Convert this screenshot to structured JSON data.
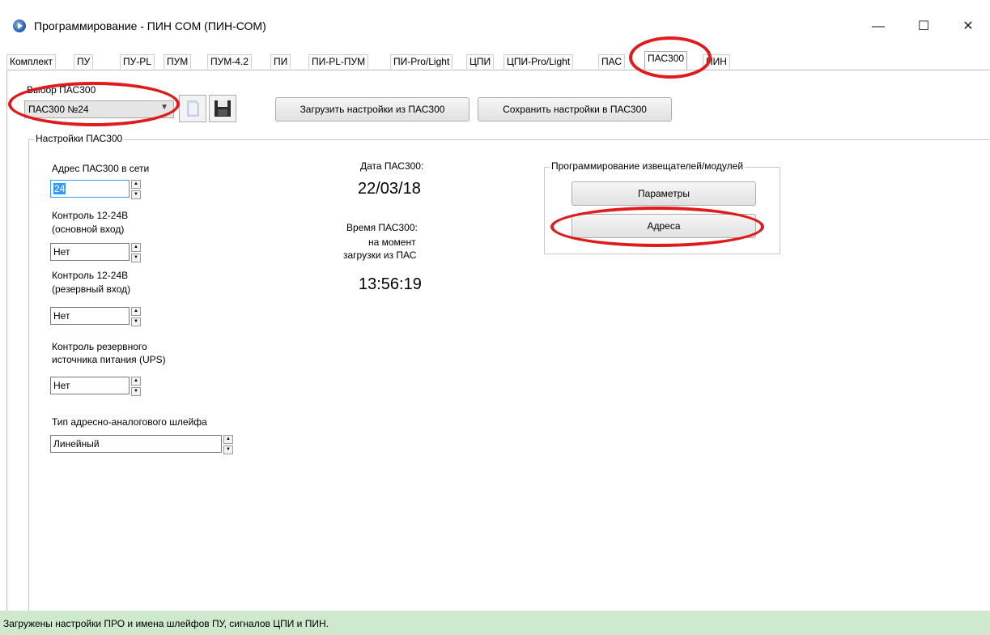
{
  "window": {
    "title": "Программирование - ПИН СОМ (ПИН-СОМ)",
    "minimize_glyph": "—",
    "maximize_glyph": "☐",
    "close_glyph": "✕"
  },
  "tabs": [
    "Комплект",
    "ПУ",
    "ПУ-PL",
    "ПУМ",
    "ПУМ-4.2",
    "ПИ",
    "ПИ-PL-ПУМ",
    "ПИ-Pro/Light",
    "ЦПИ",
    "ЦПИ-Pro/Light",
    "ПАС",
    "ПАС300",
    "ПИН"
  ],
  "active_tab": "ПАС300",
  "selector": {
    "label": "Выбор ПАС300",
    "value": "ПАС300 №24",
    "load_button": "Загрузить  настройки из ПАС300",
    "save_button": "Сохранить настройки в ПАС300",
    "open_icon": "folder-icon",
    "save_icon": "floppy-disk-icon"
  },
  "settings": {
    "group_title": "Настройки ПАС300",
    "address_label": "Адрес ПАС300 в сети",
    "address_value": "24",
    "control_main_label_1": "Контроль 12-24В",
    "control_main_label_2": "(основной вход)",
    "control_main_value": "Нет",
    "control_reserve_label_1": "Контроль 12-24В",
    "control_reserve_label_2": "(резервный вход)",
    "control_reserve_value": "Нет",
    "ups_label_1": "Контроль резервного",
    "ups_label_2": "источника питания (UPS)",
    "ups_value": "Нет",
    "loop_type_label": "Тип адресно-аналогового шлейфа",
    "loop_type_value": "Линейный"
  },
  "datetime": {
    "date_label": "Дата ПАС300:",
    "date_value": "22/03/18",
    "time_label": "Время ПАС300:",
    "time_note_1": "на момент",
    "time_note_2": "загрузки из ПАС",
    "time_value": "13:56:19"
  },
  "programming": {
    "group_title": "Программирование извещателей/модулей",
    "params_button": "Параметры",
    "address_button": "Адреса"
  },
  "status": {
    "text": "Загружены настройки ПРО и имена шлейфов ПУ, сигналов ЦПИ и ПИН.",
    "color": "#cfe9cf"
  },
  "highlight_color": "#e01b1b"
}
